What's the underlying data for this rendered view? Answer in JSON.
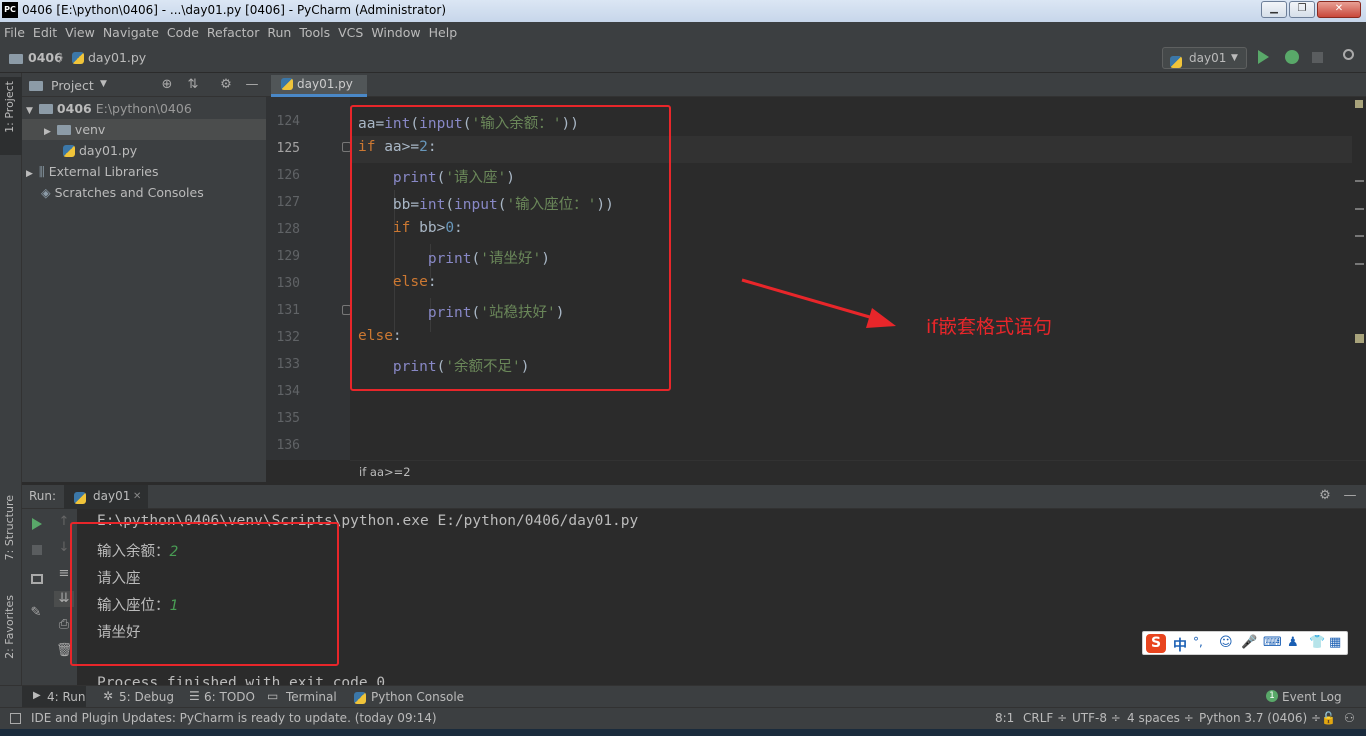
{
  "window": {
    "title": "0406 [E:\\python\\0406] - ...\\day01.py [0406] - PyCharm (Administrator)",
    "logo_text": "PC",
    "controls": [
      "▁",
      "❐",
      "✕"
    ]
  },
  "menu": [
    "File",
    "Edit",
    "View",
    "Navigate",
    "Code",
    "Refactor",
    "Run",
    "Tools",
    "VCS",
    "Window",
    "Help"
  ],
  "nav": {
    "crumbs": [
      "0406",
      "day01.py"
    ],
    "run_config": "day01"
  },
  "sidebar_tabs": {
    "project": "1: Project",
    "structure": "7: Structure",
    "favorites": "2: Favorites"
  },
  "project": {
    "header": "Project",
    "tree": [
      {
        "label": "0406",
        "path": "E:\\python\\0406"
      },
      {
        "label": "venv"
      },
      {
        "label": "day01.py"
      },
      {
        "label": "External Libraries"
      },
      {
        "label": "Scratches and Consoles"
      }
    ]
  },
  "editor": {
    "tab": "day01.py",
    "line_numbers": [
      "124",
      "125",
      "126",
      "127",
      "128",
      "129",
      "130",
      "131",
      "132",
      "133",
      "134",
      "135",
      "136"
    ],
    "lines": [
      "aa=int(input('输入余额：'))",
      "if aa>=2:",
      "    print('请入座')",
      "    bb=int(input('输入座位：'))",
      "    if bb>0:",
      "        print('请坐好')",
      "    else:",
      "        print('站稳扶好')",
      "else:",
      "    print('余额不足')"
    ],
    "breadcrumb": "if aa>=2",
    "annotation": "if嵌套格式语句",
    "annotation_color": "#e8262a"
  },
  "run": {
    "label": "Run:",
    "tab": "day01",
    "command": "E:\\python\\0406\\venv\\Scripts\\python.exe E:/python/0406/day01.py",
    "output": [
      {
        "prompt": "输入余额：",
        "input": "2"
      },
      {
        "prompt": "请入座",
        "input": ""
      },
      {
        "prompt": "输入座位：",
        "input": "1"
      },
      {
        "prompt": "请坐好",
        "input": ""
      }
    ],
    "finish": "Process finished with exit code 0"
  },
  "bottom_tabs": [
    "4: Run",
    "5: Debug",
    "6: TODO",
    "Terminal",
    "Python Console"
  ],
  "event_log": "Event Log",
  "status": {
    "message": "IDE and Plugin Updates: PyCharm is ready to update. (today 09:14)",
    "position": "8:1",
    "line_sep": "CRLF ÷",
    "encoding": "UTF-8 ÷",
    "indent": "4 spaces ÷",
    "interpreter": "Python 3.7 (0406) ÷"
  },
  "ime": {
    "logo": "S",
    "mode": "中"
  },
  "colors": {
    "accent": "#4a88c7",
    "keyword": "#cc7832",
    "string": "#6a8759",
    "number": "#6897bb",
    "builtin": "#8888c6",
    "highlight_box": "#e8262a"
  }
}
